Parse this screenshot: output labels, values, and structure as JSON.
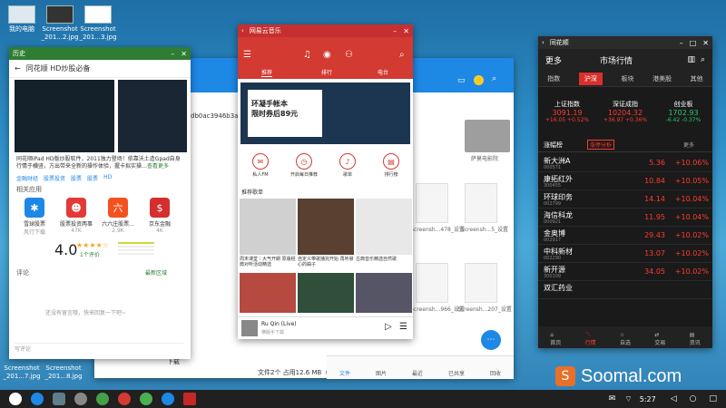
{
  "desktop": {
    "icons": [
      {
        "label": "我的电脑"
      },
      {
        "label": "Screenshot\n_201...2.jpg"
      },
      {
        "label": "Screenshot\n_201...3.jpg"
      },
      {
        "label": "Screenshot\n_201...7.jpg"
      },
      {
        "label": "Screenshot\n_201...8.jpg"
      }
    ]
  },
  "store_window": {
    "title": "历史",
    "page_title": "同花顺 HD炒股必备",
    "description": "同花顺iPad HD版炒股软件，2011独力登场！依靠沃土造Gpad自身行情于横竖，方出带来全新的操作体验，握卡拟实操…",
    "more": "查看更多",
    "tags": [
      "金融财经",
      "股票投资",
      "股票",
      "股票",
      "HD"
    ],
    "related_title": "相关应用",
    "related": [
      {
        "name": "雪球股票",
        "sub": "风行下载"
      },
      {
        "name": "股票投资两事",
        "sub": "47K"
      },
      {
        "name": "六六庄股票...",
        "sub": "2.9K"
      },
      {
        "name": "京东金融",
        "sub": "4K"
      }
    ],
    "rating": "4.0",
    "rating_count": "1个评价",
    "comment_title": "评论",
    "comment_sort": "最新区域",
    "empty_comment": "还没有留言哦，快来回复一下吧~",
    "comment_placeholder": "写评论",
    "url_fragment": "db0ac3946b3a059"
  },
  "music_window": {
    "title": "网易云音乐",
    "tabs": [
      "推荐",
      "排行",
      "电台"
    ],
    "banner_line1": "环凝手帐本",
    "banner_line2": "限时券后89元",
    "circles": [
      "私人FM",
      "开启每日推荐",
      "歌单",
      "排行榜"
    ],
    "section_title": "推荐歌单",
    "playlists": [
      {
        "caption": "周末课堂｜大气开朗 原版经典对听活动精选"
      },
      {
        "caption": "自定义带歌播完开始 再听悬心的曲子"
      },
      {
        "caption": "古典音乐精选自然歌"
      }
    ],
    "now_playing_title": "Ru Qin (Live)",
    "now_playing_sub": "横版手下载"
  },
  "file_manager": {
    "files": [
      {
        "name": "萨莫电影院"
      },
      {
        "name": "Screensh...478_设置"
      },
      {
        "name": "Screensh...5_设置"
      },
      {
        "name": "Screensh...966_设置"
      },
      {
        "name": "Screensh...207_设置"
      }
    ],
    "status": "文件2个 占用12.6 MB（已选...）",
    "download": "下载",
    "bottom_nav": [
      "文件",
      "图片",
      "最近",
      "已共享",
      "回收"
    ]
  },
  "stock_window": {
    "title": "同花顺",
    "header_left": "更多",
    "header_center": "市场行情",
    "tabs": [
      "指数",
      "沪深",
      "板块",
      "港美股",
      "其他"
    ],
    "active_tab": "沪深",
    "indices": [
      {
        "name": "上证指数",
        "value": "3091.19",
        "change": "+16.05 +0.52%"
      },
      {
        "name": "深证成指",
        "value": "10204.32",
        "change": "+36.97 +0.36%"
      },
      {
        "name": "创业板",
        "value": "1702.93",
        "change": "-6.42 -0.37%"
      }
    ],
    "list_title": "涨幅榜",
    "list_badge": "涨停分析",
    "list_more": "更多",
    "rows": [
      {
        "name": "新大洲A",
        "code": "000571",
        "price": "5.36",
        "pct": "+10.06%"
      },
      {
        "name": "康拓红外",
        "code": "300455",
        "price": "10.84",
        "pct": "+10.05%"
      },
      {
        "name": "环球印务",
        "code": "002799",
        "price": "14.14",
        "pct": "+10.04%"
      },
      {
        "name": "海信科龙",
        "code": "000921",
        "price": "11.95",
        "pct": "+10.04%"
      },
      {
        "name": "金奥博",
        "code": "002917",
        "price": "29.43",
        "pct": "+10.02%"
      },
      {
        "name": "中科新材",
        "code": "002290",
        "price": "13.07",
        "pct": "+10.02%"
      },
      {
        "name": "新开源",
        "code": "300109",
        "price": "34.05",
        "pct": "+10.02%"
      },
      {
        "name": "双汇药业",
        "code": "",
        "price": "",
        "pct": ""
      }
    ],
    "bottom_nav": [
      "首页",
      "行情",
      "自选",
      "交易",
      "资讯"
    ],
    "active_nav": "行情"
  },
  "watermark": "Soomal.com",
  "clock": "5:27"
}
